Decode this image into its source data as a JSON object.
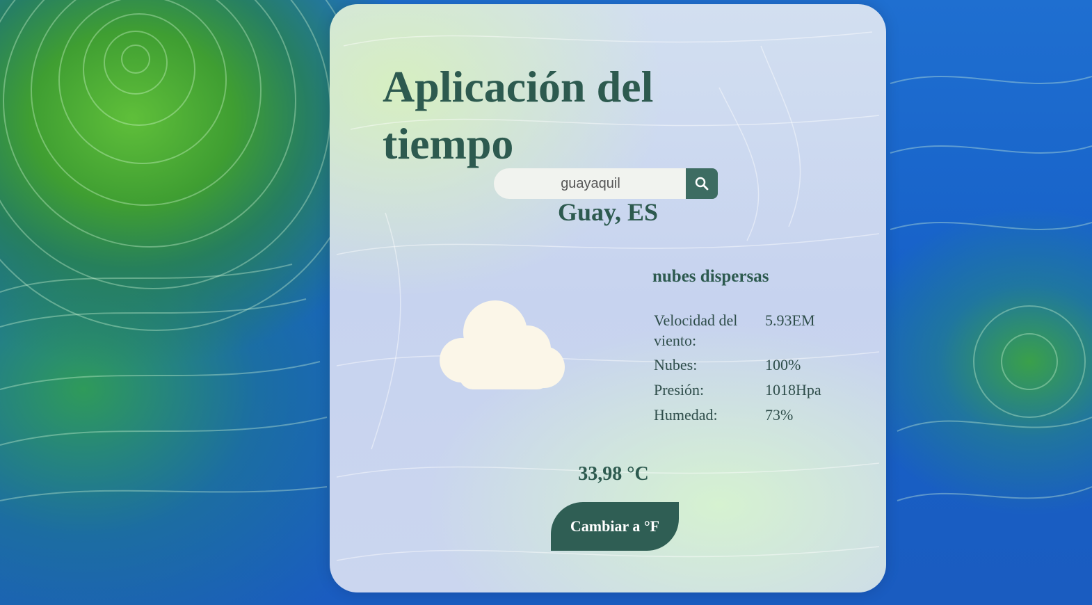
{
  "app": {
    "title": "Aplicación del tiempo"
  },
  "search": {
    "value": "guayaquil",
    "button_icon": "search-icon"
  },
  "location": {
    "name": "Guay, ES"
  },
  "weather": {
    "icon": "cloud-icon",
    "description": "nubes dispersas",
    "temperature": "33,98 °C"
  },
  "stats": {
    "wind_label": "Velocidad del viento:",
    "wind_value": "5.93EM",
    "clouds_label": "Nubes:",
    "clouds_value": "100%",
    "pressure_label": "Presión:",
    "pressure_value": "1018Hpa",
    "humidity_label": "Humedad:",
    "humidity_value": "73%"
  },
  "controls": {
    "unit_toggle_label": "Cambiar a °F"
  },
  "colors": {
    "primary": "#2d5a4f",
    "button": "#2f5e54",
    "card": "#c9d5ef"
  }
}
